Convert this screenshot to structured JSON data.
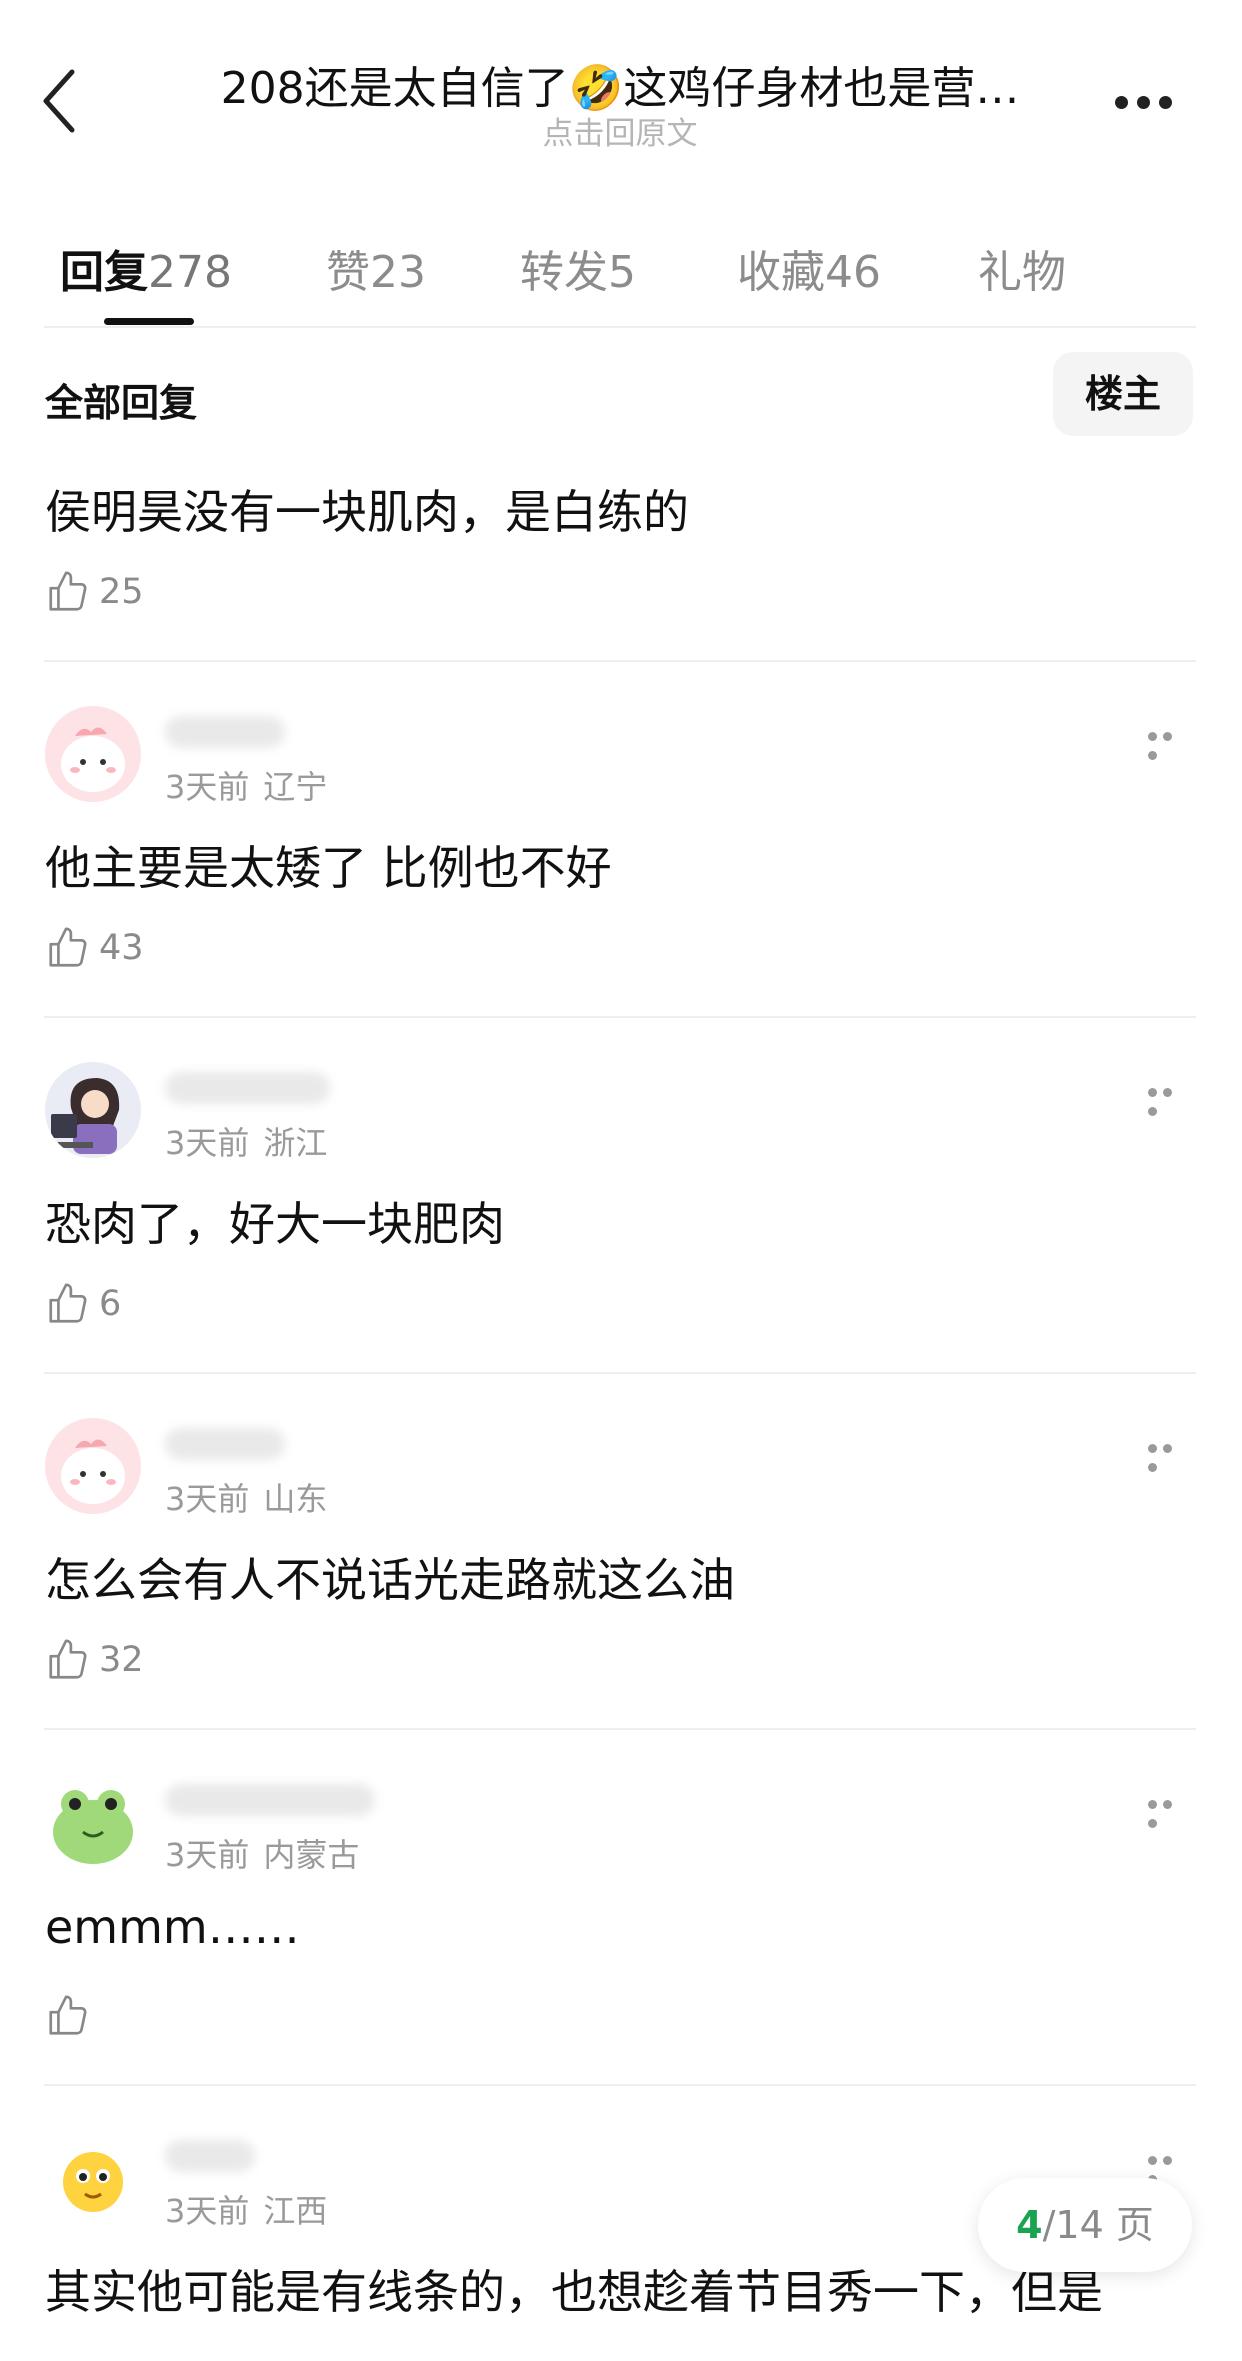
{
  "header": {
    "title": "208还是太自信了🤣这鸡仔身材也是营…",
    "subtitle": "点击回原文"
  },
  "tabs": [
    {
      "label": "回复",
      "count": "278"
    },
    {
      "label": "赞",
      "count": "23"
    },
    {
      "label": "转发",
      "count": "5"
    },
    {
      "label": "收藏",
      "count": "46"
    },
    {
      "label": "礼物",
      "count": ""
    }
  ],
  "section": {
    "title": "全部回复",
    "op_button": "楼主"
  },
  "first_reply": {
    "text": "侯明昊没有一块肌肉，是白练的",
    "likes": "25"
  },
  "replies": [
    {
      "avatar": "pink-blob",
      "time": "3天前",
      "location": "辽宁",
      "text": "他主要是太矮了 比例也不好",
      "likes": "43"
    },
    {
      "avatar": "girl-computer",
      "time": "3天前",
      "location": "浙江",
      "text": "恐肉了，好大一块肥肉",
      "likes": "6"
    },
    {
      "avatar": "pink-blob",
      "time": "3天前",
      "location": "山东",
      "text": "怎么会有人不说话光走路就这么油",
      "likes": "32"
    },
    {
      "avatar": "green-frog",
      "time": "3天前",
      "location": "内蒙古",
      "text": "emmm……",
      "likes": ""
    },
    {
      "avatar": "yellow-emoji",
      "time": "3天前",
      "location": "江西",
      "text": "其实他可能是有线条的，也想趁着节目秀一下，但是",
      "likes": ""
    }
  ],
  "pager": {
    "current": "4",
    "total": "/14 页"
  }
}
